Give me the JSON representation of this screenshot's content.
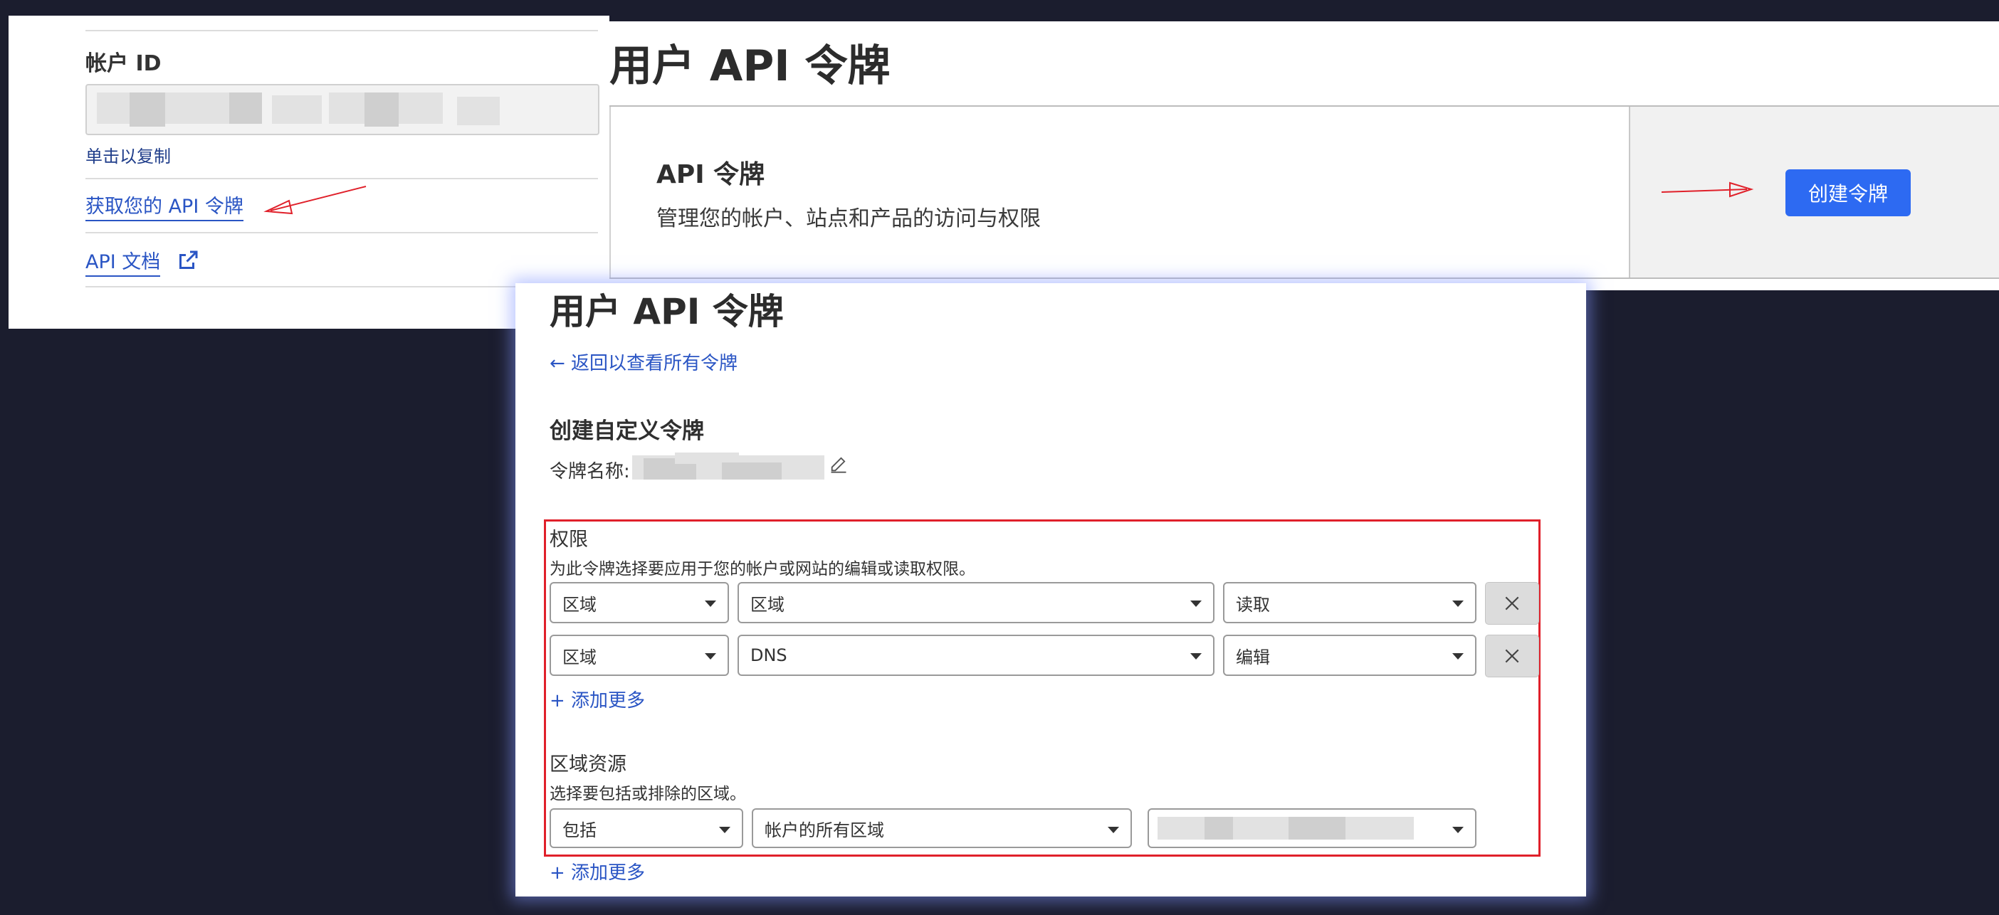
{
  "account_panel": {
    "account_id_label": "帐户 ID",
    "copy_hint": "单击以复制",
    "get_token_link": "获取您的 API 令牌",
    "api_docs_link": "API 文档"
  },
  "tokens_panel": {
    "title": "用户 API 令牌",
    "card_title": "API 令牌",
    "card_description": "管理您的帐户、站点和产品的访问与权限",
    "create_button": "创建令牌"
  },
  "create_panel": {
    "title": "用户 API 令牌",
    "back_link": "← 返回以查看所有令牌",
    "subtitle": "创建自定义令牌",
    "token_name_label": "令牌名称:",
    "permissions": {
      "heading": "权限",
      "description": "为此令牌选择要应用于您的帐户或网站的编辑或读取权限。",
      "rows": [
        {
          "scope": "区域",
          "item": "区域",
          "access": "读取"
        },
        {
          "scope": "区域",
          "item": "DNS",
          "access": "编辑"
        }
      ],
      "add_more": "+ 添加更多"
    },
    "zone_resources": {
      "heading": "区域资源",
      "description": "选择要包括或排除的区域。",
      "include": "包括",
      "target": "帐户的所有区域",
      "add_more": "+ 添加更多"
    }
  },
  "colors": {
    "background": "#1b1d2e",
    "link": "#2a55c4",
    "primary_button": "#2d6af2",
    "annotation_red": "#e0202a"
  },
  "icons": [
    "external-link-icon",
    "pencil-icon",
    "close-icon",
    "chevron-down-icon",
    "arrow-left-icon"
  ]
}
